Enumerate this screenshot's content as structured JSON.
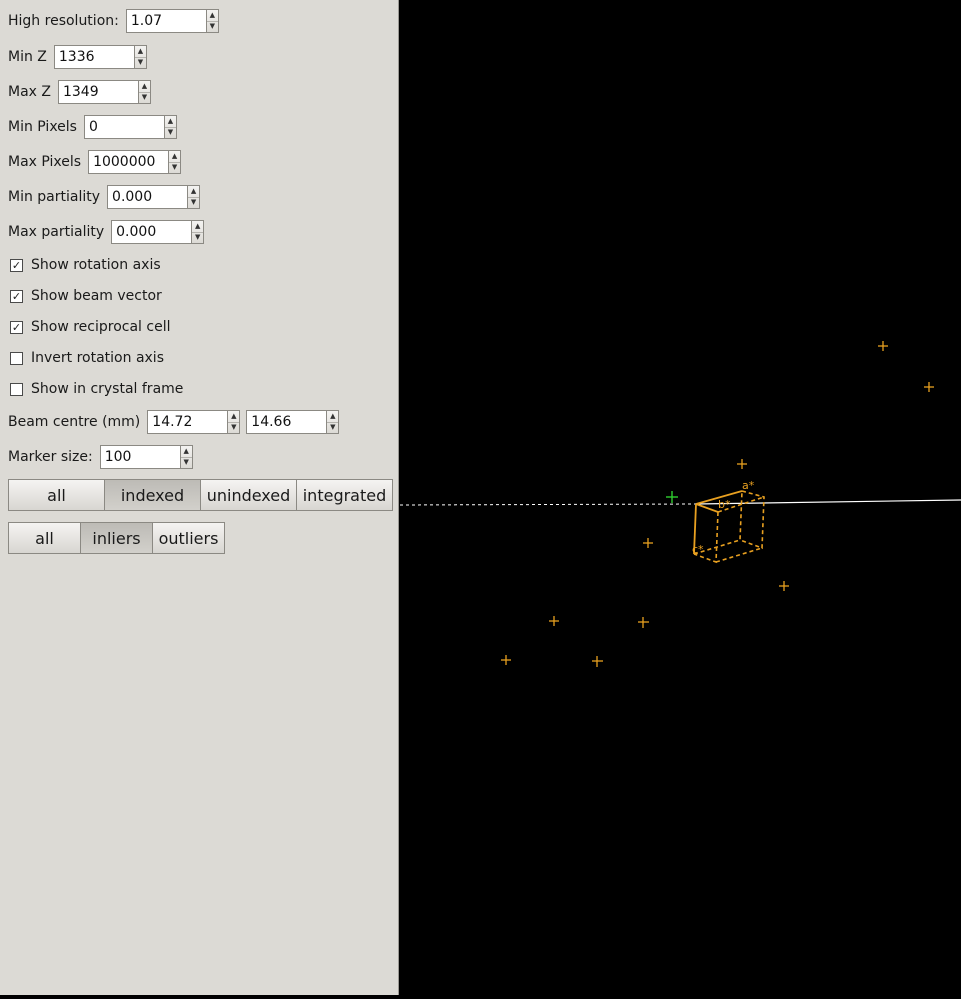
{
  "controls": {
    "high_resolution": {
      "label": "High resolution:",
      "value": "1.07"
    },
    "min_z": {
      "label": "Min Z",
      "value": "1336"
    },
    "max_z": {
      "label": "Max Z",
      "value": "1349"
    },
    "min_pixels": {
      "label": "Min Pixels",
      "value": "0"
    },
    "max_pixels": {
      "label": "Max Pixels",
      "value": "1000000"
    },
    "min_partiality": {
      "label": "Min partiality",
      "value": "0.000"
    },
    "max_partiality": {
      "label": "Max partiality",
      "value": "0.000"
    },
    "beam_centre": {
      "label": "Beam centre (mm)",
      "x": "14.72",
      "y": "14.66"
    },
    "marker_size": {
      "label": "Marker size:",
      "value": "100"
    }
  },
  "checkboxes": {
    "show_rotation_axis": {
      "label": "Show rotation axis",
      "checked": true,
      "mark": "✓"
    },
    "show_beam_vector": {
      "label": "Show beam vector",
      "checked": true,
      "mark": "✓"
    },
    "show_reciprocal_cell": {
      "label": "Show reciprocal cell",
      "checked": true,
      "mark": "✓"
    },
    "invert_rotation_axis": {
      "label": "Invert rotation axis",
      "checked": false,
      "mark": ""
    },
    "show_crystal_frame": {
      "label": "Show in crystal frame",
      "checked": false,
      "mark": ""
    }
  },
  "filter_reflections": {
    "options": [
      "all",
      "indexed",
      "unindexed",
      "integrated"
    ],
    "selected": "indexed"
  },
  "filter_outliers": {
    "options": [
      "all",
      "inliers",
      "outliers"
    ],
    "selected": "inliers"
  },
  "viewer": {
    "background": "#000000",
    "spot_color": "#e8a020",
    "center_marker_color": "#2ecc2e",
    "cell_color": "#e8a020",
    "axis_color": "#ffffff",
    "cell_labels": {
      "a": "a*",
      "b": "b*",
      "c": "c*"
    }
  }
}
